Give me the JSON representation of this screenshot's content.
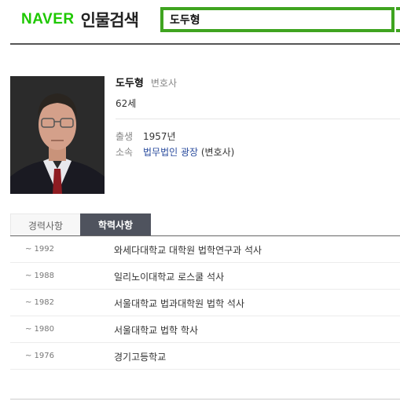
{
  "header": {
    "logo_brand": "NAVER",
    "logo_service": "인물검색",
    "search_value": "도두형",
    "accent_color": "#3fa420"
  },
  "profile": {
    "name": "도두형",
    "job": "변호사",
    "age": "62세",
    "birth_label": "출생",
    "birth_value": "1957년",
    "org_label": "소속",
    "org_link": "법무법인 광장",
    "org_suffix": " (변호사)"
  },
  "tabs": [
    {
      "label": "경력사항",
      "active": false
    },
    {
      "label": "학력사항",
      "active": true
    }
  ],
  "education": [
    {
      "year": "~ 1992",
      "school": "와세다대학교 대학원 법학연구과 석사"
    },
    {
      "year": "~ 1988",
      "school": "일리노이대학교 로스쿨 석사"
    },
    {
      "year": "~ 1982",
      "school": "서울대학교 법과대학원 법학 석사"
    },
    {
      "year": "~ 1980",
      "school": "서울대학교 법학 학사"
    },
    {
      "year": "~ 1976",
      "school": "경기고등학교"
    }
  ]
}
